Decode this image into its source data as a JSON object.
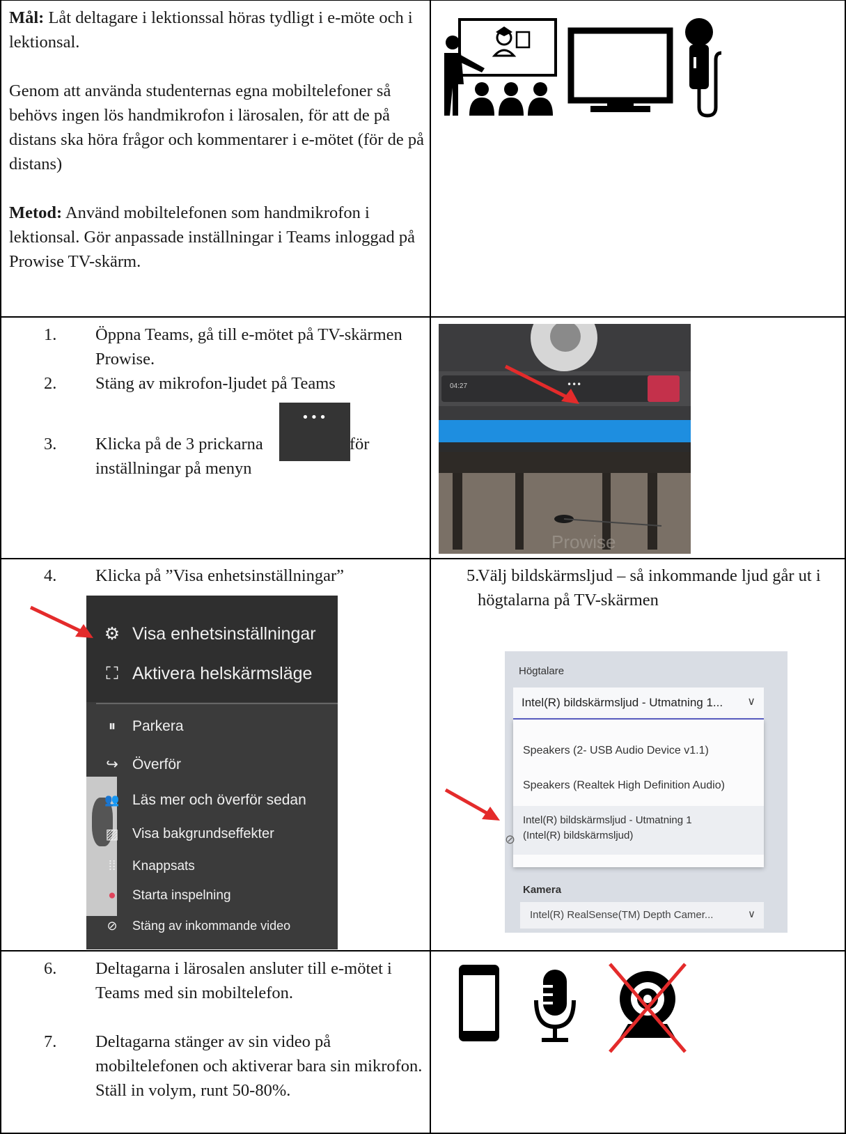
{
  "row1": {
    "goal_label": "Mål:",
    "goal_text": " Låt deltagare i lektionssal höras tydligt i e-möte och i lektionsal.",
    "para2": "Genom att använda studenternas egna mobiltelefoner så behövs ingen lös handmikrofon i lärosalen, för att de på distans ska höra frågor och kommentarer i e-mötet (för de på distans)",
    "method_label": "Metod:",
    "method_text": " Använd mobiltelefonen som handmikrofon i lektionsal. Gör anpassade inställningar i Teams inloggad på Prowise TV-skärm."
  },
  "row2": {
    "steps": [
      {
        "num": "1.",
        "text": "Öppna Teams, gå till e-mötet på TV-skärmen Prowise."
      },
      {
        "num": "2.",
        "text": "Stäng av mikrofon-ljudet på Teams"
      },
      {
        "num": "3.",
        "text_a": "Klicka på de 3 prickarna",
        "text_b": "för",
        "text_c": "inställningar på menyn"
      }
    ],
    "more_glyph": "•••",
    "toolbar_time": "04:27",
    "watermark": "Prowise"
  },
  "row3": {
    "step4_num": "4.",
    "step4_text": "Klicka på ”Visa enhetsinställningar”",
    "step5_num": "5.",
    "step5_text": "Välj bildskärmsljud – så inkommande ljud går ut i högtalarna på TV-skärmen",
    "menu": [
      {
        "icon": "gear-icon",
        "glyph": "⚙",
        "label": "Visa enhetsinställningar"
      },
      {
        "icon": "fullscreen-icon",
        "glyph": "⛶",
        "label": "Aktivera helskärmsläge"
      },
      {
        "icon": "park-icon",
        "glyph": "⏸",
        "label": "Parkera"
      },
      {
        "icon": "transfer-icon",
        "glyph": "↪",
        "label": "Överför"
      },
      {
        "icon": "people-icon",
        "glyph": "👥",
        "label": "Läs mer och överför sedan"
      },
      {
        "icon": "background-icon",
        "glyph": "▨",
        "label": "Visa bakgrundseffekter"
      },
      {
        "icon": "keypad-icon",
        "glyph": "⁞⁞",
        "label": "Knappsats"
      },
      {
        "icon": "record-icon",
        "glyph": "●",
        "label": "Starta inspelning"
      },
      {
        "icon": "video-off-icon",
        "glyph": "⊘",
        "label": "Stäng av inkommande video"
      }
    ],
    "audio": {
      "speaker_label": "Högtalare",
      "selected": "Intel(R) bildskärmsljud - Utmatning 1...",
      "options": [
        "Speakers (2- USB Audio Device v1.1)",
        "Speakers (Realtek High Definition Audio)",
        "Intel(R) bildskärmsljud - Utmatning 1 (Intel(R) bildskärmsljud)"
      ],
      "camera_label": "Kamera",
      "camera_value": "Intel(R) RealSense(TM) Depth Camer..."
    }
  },
  "row4": {
    "steps": [
      {
        "num": "6.",
        "text": "Deltagarna i lärosalen ansluter till e-mötet i Teams med sin mobiltelefon."
      },
      {
        "num": "7.",
        "text": "Deltagarna stänger av sin video på mobiltelefonen och aktiverar bara sin mikrofon. Ställ in volym, runt 50-80%."
      }
    ]
  }
}
